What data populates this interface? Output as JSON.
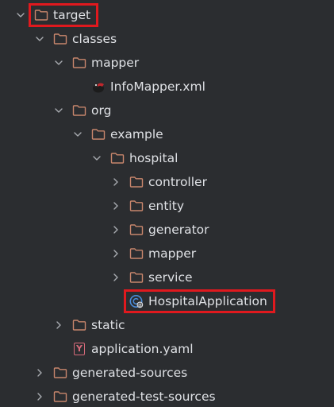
{
  "colors": {
    "background": "#2b2d30",
    "text": "#dfe1e5",
    "folder_stroke": "#c8866c",
    "chevron": "#a8abb0",
    "highlight": "#e0191e",
    "class_icon": "#4a8bd8",
    "yaml_icon": "#d66a7a"
  },
  "tree": [
    {
      "id": "target",
      "label": "target",
      "level": 0,
      "expanded": true,
      "icon": "folder-icon"
    },
    {
      "id": "classes",
      "label": "classes",
      "level": 1,
      "expanded": true,
      "icon": "folder-icon"
    },
    {
      "id": "mapper-dir",
      "label": "mapper",
      "level": 2,
      "expanded": true,
      "icon": "folder-icon"
    },
    {
      "id": "infomapper-xml",
      "label": "InfoMapper.xml",
      "level": 3,
      "expanded": null,
      "icon": "mybatis-xml-icon"
    },
    {
      "id": "org",
      "label": "org",
      "level": 2,
      "expanded": true,
      "icon": "folder-icon"
    },
    {
      "id": "example",
      "label": "example",
      "level": 3,
      "expanded": true,
      "icon": "folder-icon"
    },
    {
      "id": "hospital",
      "label": "hospital",
      "level": 4,
      "expanded": true,
      "icon": "folder-icon"
    },
    {
      "id": "controller",
      "label": "controller",
      "level": 5,
      "expanded": false,
      "icon": "folder-icon"
    },
    {
      "id": "entity",
      "label": "entity",
      "level": 5,
      "expanded": false,
      "icon": "folder-icon"
    },
    {
      "id": "generator",
      "label": "generator",
      "level": 5,
      "expanded": false,
      "icon": "folder-icon"
    },
    {
      "id": "mapper-pkg",
      "label": "mapper",
      "level": 5,
      "expanded": false,
      "icon": "folder-icon"
    },
    {
      "id": "service",
      "label": "service",
      "level": 5,
      "expanded": false,
      "icon": "folder-icon"
    },
    {
      "id": "hospital-application",
      "label": "HospitalApplication",
      "level": 5,
      "expanded": null,
      "icon": "spring-boot-class-icon"
    },
    {
      "id": "static",
      "label": "static",
      "level": 2,
      "expanded": false,
      "icon": "folder-icon"
    },
    {
      "id": "application-yaml",
      "label": "application.yaml",
      "level": 2,
      "expanded": null,
      "icon": "yaml-icon"
    },
    {
      "id": "generated-sources",
      "label": "generated-sources",
      "level": 1,
      "expanded": false,
      "icon": "folder-icon"
    },
    {
      "id": "generated-test-sources",
      "label": "generated-test-sources",
      "level": 1,
      "expanded": false,
      "icon": "folder-icon"
    }
  ],
  "yaml_glyph": "Y",
  "highlighted": [
    "target",
    "hospital-application"
  ]
}
